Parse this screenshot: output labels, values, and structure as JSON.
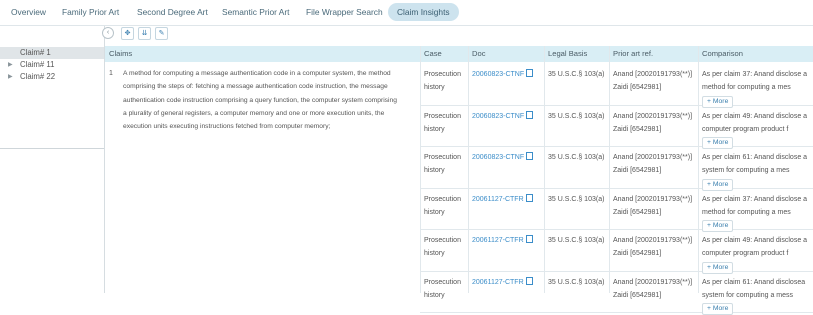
{
  "tabs": [
    "Overview",
    "Family Prior Art",
    "Second Degree Art",
    "Semantic Prior Art",
    "File Wrapper Search",
    "Claim Insights"
  ],
  "active_tab": "Claim Insights",
  "tree": [
    {
      "label": "Claim# 1",
      "selected": true
    },
    {
      "label": "Claim# 11",
      "selected": false
    },
    {
      "label": "Claim# 22",
      "selected": false
    }
  ],
  "toolbar": {
    "collapse": "‹",
    "expand_all": "✥",
    "sort": "⇊",
    "edit": "✎"
  },
  "columns": {
    "claims": "Claims",
    "case": "Case",
    "doc": "Doc",
    "legal": "Legal Basis",
    "prior": "Prior art ref.",
    "comparison": "Comparison"
  },
  "claim": {
    "number": "1",
    "lines": [
      "A method for computing a message authentication code in a computer system, the method",
      "comprising the steps of: fetching a message authentication code instruction, the message",
      "authentication code instruction comprising a query function, the computer system comprising",
      "a plurality of general registers, a computer memory and one or more execution units, the",
      "execution units executing instructions fetched from computer memory;"
    ]
  },
  "rows": [
    {
      "case1": "Prosecution",
      "case2": "history",
      "doc": "20060823-CTNF",
      "legal": "35 U.S.C.§ 103(a)",
      "prior1": "Anand [20020191793(**)]",
      "prior2": "Zaidi [6542981]",
      "comp1": "As per claim 37: Anand disclose a",
      "comp2": "method for computing a mes",
      "more": "+ More"
    },
    {
      "case1": "Prosecution",
      "case2": "history",
      "doc": "20060823-CTNF",
      "legal": "35 U.S.C.§ 103(a)",
      "prior1": "Anand [20020191793(**)]",
      "prior2": "Zaidi [6542981]",
      "comp1": "As per claim 49: Anand disclose a",
      "comp2": "computer program product f",
      "more": "+ More"
    },
    {
      "case1": "Prosecution",
      "case2": "history",
      "doc": "20060823-CTNF",
      "legal": "35 U.S.C.§ 103(a)",
      "prior1": "Anand [20020191793(**)]",
      "prior2": "Zaidi [6542981]",
      "comp1": "As per claim 61: Anand disclose a",
      "comp2": "system for computing a mes",
      "more": "+ More"
    },
    {
      "case1": "Prosecution",
      "case2": "history",
      "doc": "20061127-CTFR",
      "legal": "35 U.S.C.§ 103(a)",
      "prior1": "Anand [20020191793(**)]",
      "prior2": "Zaidi [6542981]",
      "comp1": "As per claim 37: Anand disclose a",
      "comp2": "method for computing a mes",
      "more": "+ More"
    },
    {
      "case1": "Prosecution",
      "case2": "history",
      "doc": "20061127-CTFR",
      "legal": "35 U.S.C.§ 103(a)",
      "prior1": "Anand [20020191793(**)]",
      "prior2": "Zaidi [6542981]",
      "comp1": "As per claim 49: Anand disclose a",
      "comp2": "computer program product f",
      "more": "+ More"
    },
    {
      "case1": "Prosecution",
      "case2": "history",
      "doc": "20061127-CTFR",
      "legal": "35 U.S.C.§ 103(a)",
      "prior1": "Anand [20020191793(**)]",
      "prior2": "Zaidi [6542981]",
      "comp1": "As per claim 61: Anand disclosea",
      "comp2": "system for computing a mess",
      "more": "+ More"
    }
  ]
}
